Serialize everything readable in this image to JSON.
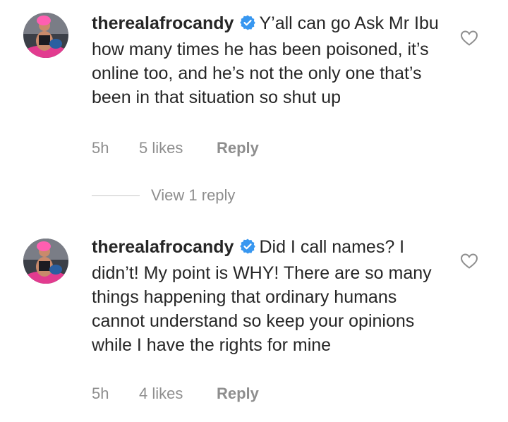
{
  "comments": [
    {
      "username": "therealafrocandy",
      "text": "Y’all can go Ask Mr Ibu how many times he has been poisoned, it’s online too, and he’s not the only one that’s been in that situation so shut up",
      "time": "5h",
      "likes": "5 likes",
      "reply_label": "Reply"
    },
    {
      "username": "therealafrocandy",
      "text": "Did I call names? I didn’t! My point is WHY! There are so many things happening that ordinary humans cannot understand so keep your opinions while I have the rights for mine",
      "time": "5h",
      "likes": "4 likes",
      "reply_label": "Reply"
    }
  ],
  "view_replies_label": "View 1 reply",
  "icons": {
    "verified": "verified-badge-icon",
    "like": "heart-outline-icon"
  },
  "colors": {
    "text": "#262626",
    "secondary": "#8e8e8e",
    "verified_blue": "#3897f0",
    "divider": "#c7c7c7"
  }
}
